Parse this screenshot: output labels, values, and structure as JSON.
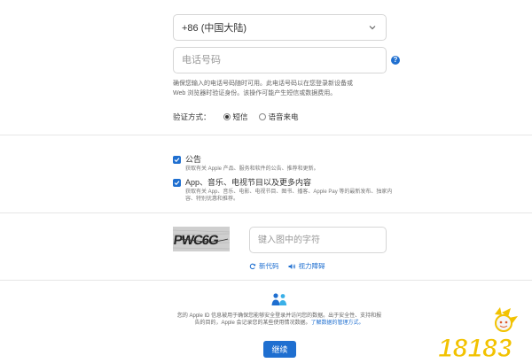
{
  "country": {
    "selected": "+86 (中国大陆)"
  },
  "phone": {
    "placeholder": "电话号码"
  },
  "note": {
    "line1": "确保您输入的电话号码随时可用。此电话号码以在您登录新设备或",
    "line2": "Web 浏览器时验证身份。该操作可能产生短信或数据费用。"
  },
  "verify": {
    "label": "验证方式：",
    "options": [
      "短信",
      "语音来电"
    ],
    "selected_index": 0
  },
  "subscriptions": [
    {
      "title": "公告",
      "desc": "获取有关 Apple 产品、服务和软件的公告、推荐和更新。",
      "checked": true
    },
    {
      "title": "App、音乐、电视节目以及更多内容",
      "desc": "获取有关 App、音乐、电影、电视节目、图书、播客、Apple Pay 等的最新发布、独家内容、特别优惠和推荐。",
      "checked": true
    }
  ],
  "captcha": {
    "image_text": "PWC6G",
    "placeholder": "键入图中的字符",
    "new_code": "新代码",
    "vision_impaired": "视力障碍"
  },
  "privacy": {
    "line1": "您的 Apple ID 信息被用于确保您能够安全登录并访问您的数据。出于安全性、支持和报",
    "line2": "告的目的，Apple 会记录您的某些使用情况数据。",
    "link": "了解数据的管理方式。"
  },
  "continue_label": "继续",
  "watermark": {
    "text": "18183"
  },
  "colors": {
    "accent": "#1f6fd0",
    "watermark": "#f2c200"
  },
  "icons": {
    "country": "chevron-down-icon",
    "help": "question-mark-icon",
    "new_code": "refresh-icon",
    "vision": "speaker-icon",
    "privacy": "people-icon"
  }
}
